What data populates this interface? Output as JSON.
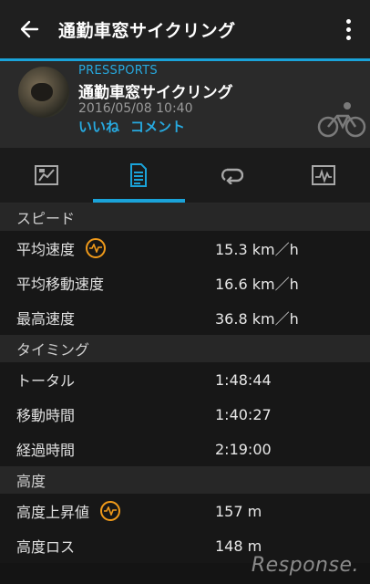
{
  "appbar": {
    "title": "通勤車窓サイクリング"
  },
  "header": {
    "source": "PRESSPORTS",
    "title": "通勤車窓サイクリング",
    "date": "2016/05/08 10:40",
    "like": "いいね",
    "comment": "コメント"
  },
  "tabs": [
    {
      "icon": "overview-icon",
      "active": false
    },
    {
      "icon": "details-icon",
      "active": true
    },
    {
      "icon": "laps-icon",
      "active": false
    },
    {
      "icon": "chart-icon",
      "active": false
    }
  ],
  "sections": [
    {
      "title": "スピード",
      "rows": [
        {
          "label": "平均速度",
          "value": "15.3 km／h",
          "icon": "pulse-icon"
        },
        {
          "label": "平均移動速度",
          "value": "16.6 km／h"
        },
        {
          "label": "最高速度",
          "value": "36.8 km／h"
        }
      ]
    },
    {
      "title": "タイミング",
      "rows": [
        {
          "label": "トータル",
          "value": "1:48:44"
        },
        {
          "label": "移動時間",
          "value": "1:40:27"
        },
        {
          "label": "経過時間",
          "value": "2:19:00"
        }
      ]
    },
    {
      "title": "高度",
      "rows": [
        {
          "label": "高度上昇値",
          "value": "157 m",
          "icon": "pulse-icon"
        },
        {
          "label": "高度ロス",
          "value": "148 m"
        }
      ]
    }
  ],
  "watermark": "Response.",
  "colors": {
    "accent": "#1aa3d9",
    "link": "#27a9df",
    "badge": "#f09a1a"
  }
}
